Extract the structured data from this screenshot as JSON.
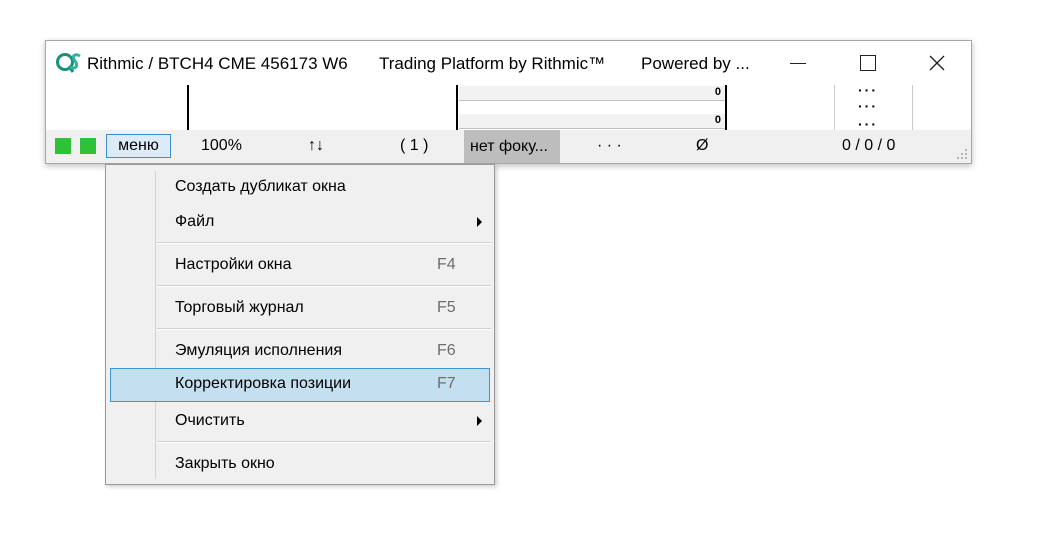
{
  "window": {
    "title_main": "Rithmic / BTCH4 CME 456173 W6",
    "title_platform": "Trading Platform by Rithmic™",
    "title_powered": "Powered by ...",
    "logo_text": "QS"
  },
  "content": {
    "row_values": [
      "0",
      "0"
    ]
  },
  "statusbar": {
    "colors": {
      "indicator": "#2ec337"
    },
    "menu_label": "меню",
    "zoom": "100%",
    "sort_glyph": "↑↓",
    "count": "( 1 )",
    "focus_text": "нет фоку...",
    "ellipsis": "· · ·",
    "empty_symbol": "Ø",
    "position": "0  /  0  /  0"
  },
  "context_menu": {
    "items": [
      {
        "label": "Создать дубликат окна",
        "key": ""
      },
      {
        "label": "Файл",
        "key": ""
      },
      {
        "label": "Настройки окна",
        "key": "F4"
      },
      {
        "label": "Торговый журнал",
        "key": "F5"
      },
      {
        "label": "Эмуляция исполнения",
        "key": "F6"
      },
      {
        "label": "Корректировка позиции",
        "key": "F7"
      },
      {
        "label": "Очистить",
        "key": ""
      },
      {
        "label": "Закрыть окно",
        "key": ""
      }
    ]
  }
}
